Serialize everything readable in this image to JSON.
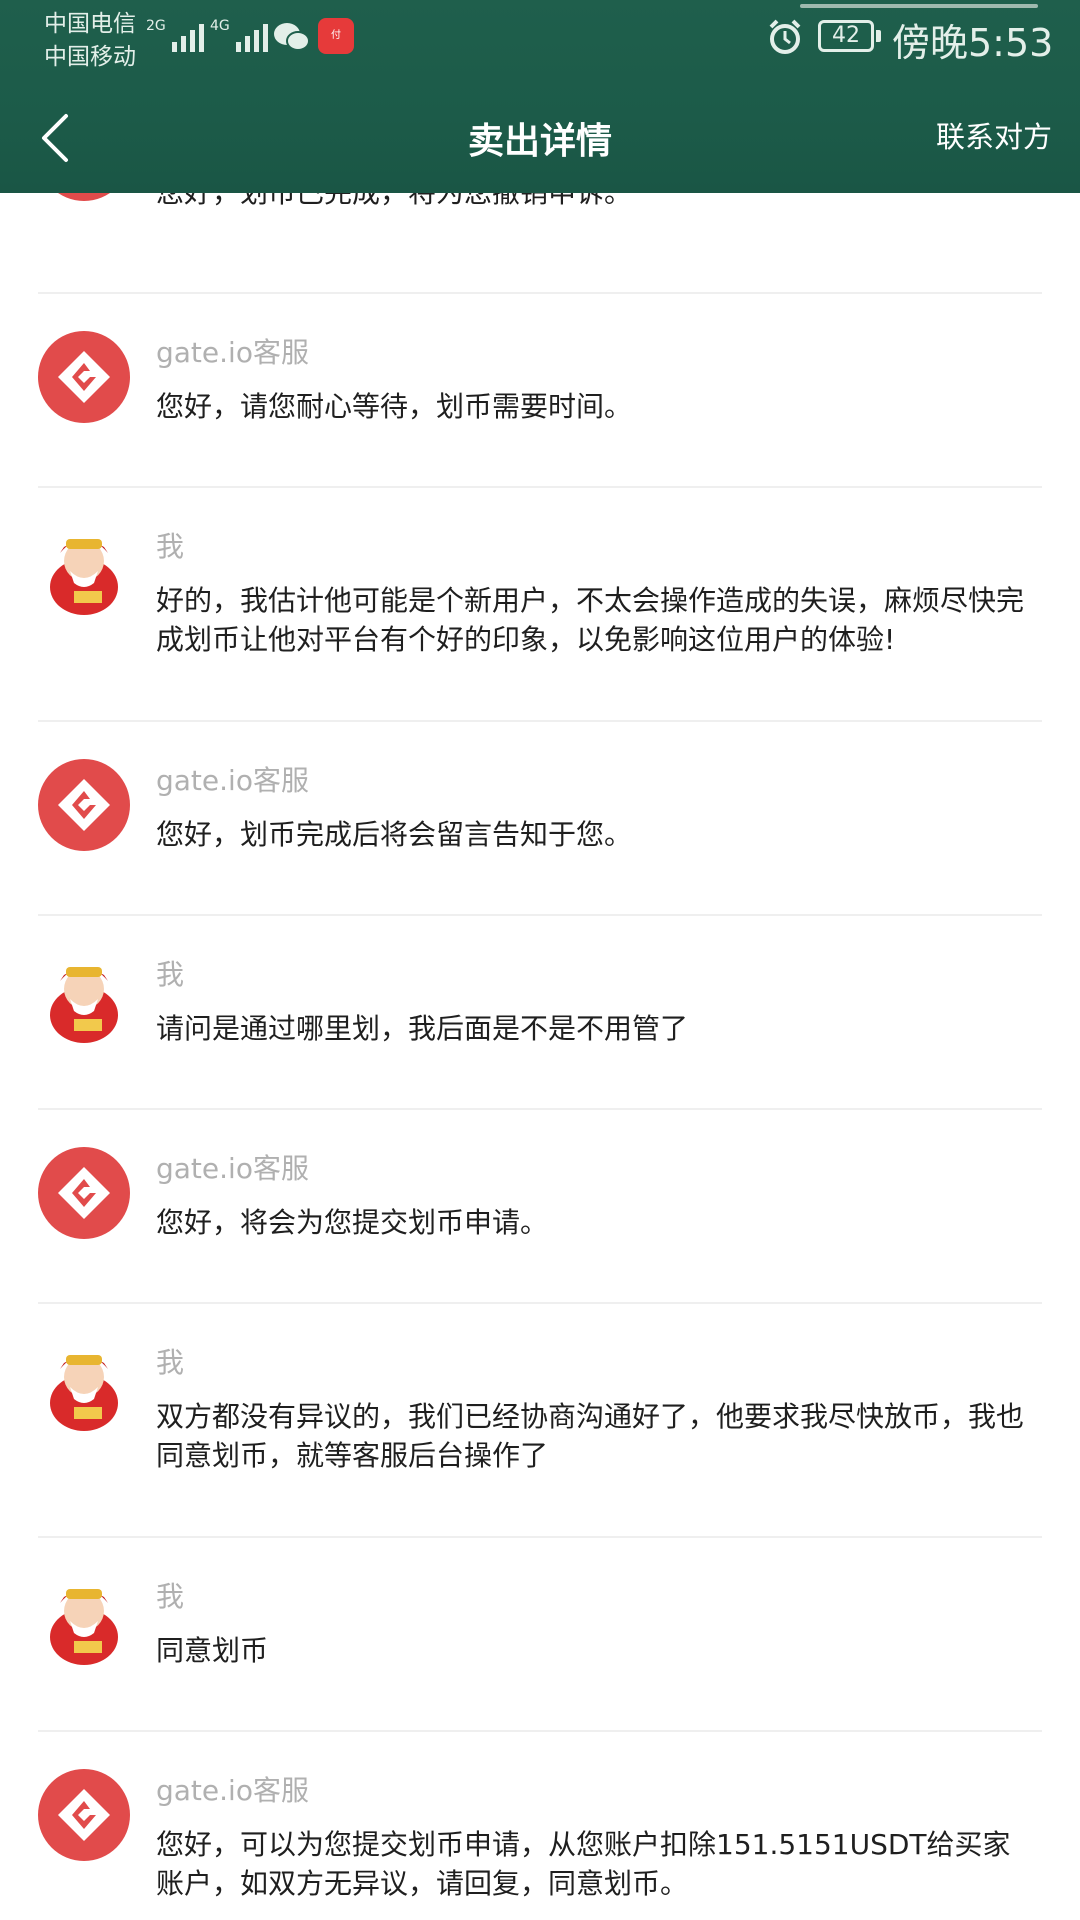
{
  "status": {
    "carrier1": "中国电信",
    "carrier2": "中国移动",
    "net1": "2G",
    "net2": "4G",
    "battery": "42",
    "time": "傍晚5:53"
  },
  "nav": {
    "title": "卖出详情",
    "contact": "联系对方"
  },
  "messages": [
    {
      "sender": "",
      "text": "您好，划币已完成，将为您撤销申诉。"
    },
    {
      "sender": "gate.io客服",
      "text": "您好，请您耐心等待，划币需要时间。"
    },
    {
      "sender": "我",
      "text": "好的，我估计他可能是个新用户，不太会操作造成的失误，麻烦尽快完成划币让他对平台有个好的印象，以免影响这位用户的体验!"
    },
    {
      "sender": "gate.io客服",
      "text": "您好，划币完成后将会留言告知于您。"
    },
    {
      "sender": "我",
      "text": "请问是通过哪里划，我后面是不是不用管了"
    },
    {
      "sender": "gate.io客服",
      "text": "您好，将会为您提交划币申请。"
    },
    {
      "sender": "我",
      "text": "双方都没有异议的，我们已经协商沟通好了，他要求我尽快放币，我也同意划币，就等客服后台操作了"
    },
    {
      "sender": "我",
      "text": "同意划币"
    },
    {
      "sender": "gate.io客服",
      "text": "您好，可以为您提交划币申请，从您账户扣除151.5151USDT给买家账户，如双方无异议，请回复，同意划币。"
    }
  ],
  "colors": {
    "header": "#1c5b49",
    "service_avatar": "#e14b4b",
    "sender": "#b0b0b0",
    "text": "#1f1f1f"
  },
  "icons": {
    "back": "chevron-left-icon",
    "service": "gate-logo-icon",
    "me": "fortune-god-avatar-icon"
  }
}
